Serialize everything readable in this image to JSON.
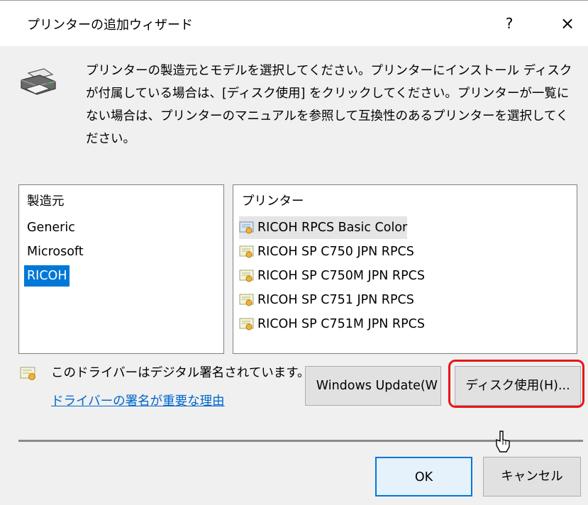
{
  "window": {
    "title": "プリンターの追加ウィザード",
    "help": "?",
    "close": "×"
  },
  "description": "プリンターの製造元とモデルを選択してください。プリンターにインストール ディスクが付属している場合は、[ディスク使用] をクリックしてください。プリンターが一覧にない場合は、プリンターのマニュアルを参照して互換性のあるプリンターを選択してください。",
  "manufacturers": {
    "header": "製造元",
    "items": [
      "Generic",
      "Microsoft",
      "RICOH"
    ],
    "selected": "RICOH"
  },
  "printers": {
    "header": "プリンター",
    "items": [
      "RICOH RPCS Basic Color",
      "RICOH SP C750 JPN RPCS",
      "RICOH SP C750M JPN RPCS",
      "RICOH SP C751 JPN RPCS",
      "RICOH SP C751M JPN RPCS"
    ]
  },
  "signature": {
    "text": "このドライバーはデジタル署名されています。",
    "link": "ドライバーの署名が重要な理由"
  },
  "buttons": {
    "windows_update": "Windows Update(W",
    "have_disk": "ディスク使用(H)...",
    "ok": "OK",
    "cancel": "キャンセル"
  },
  "colors": {
    "selection": "#0078d7",
    "link": "#0066cc",
    "highlight": "#e8141b"
  }
}
